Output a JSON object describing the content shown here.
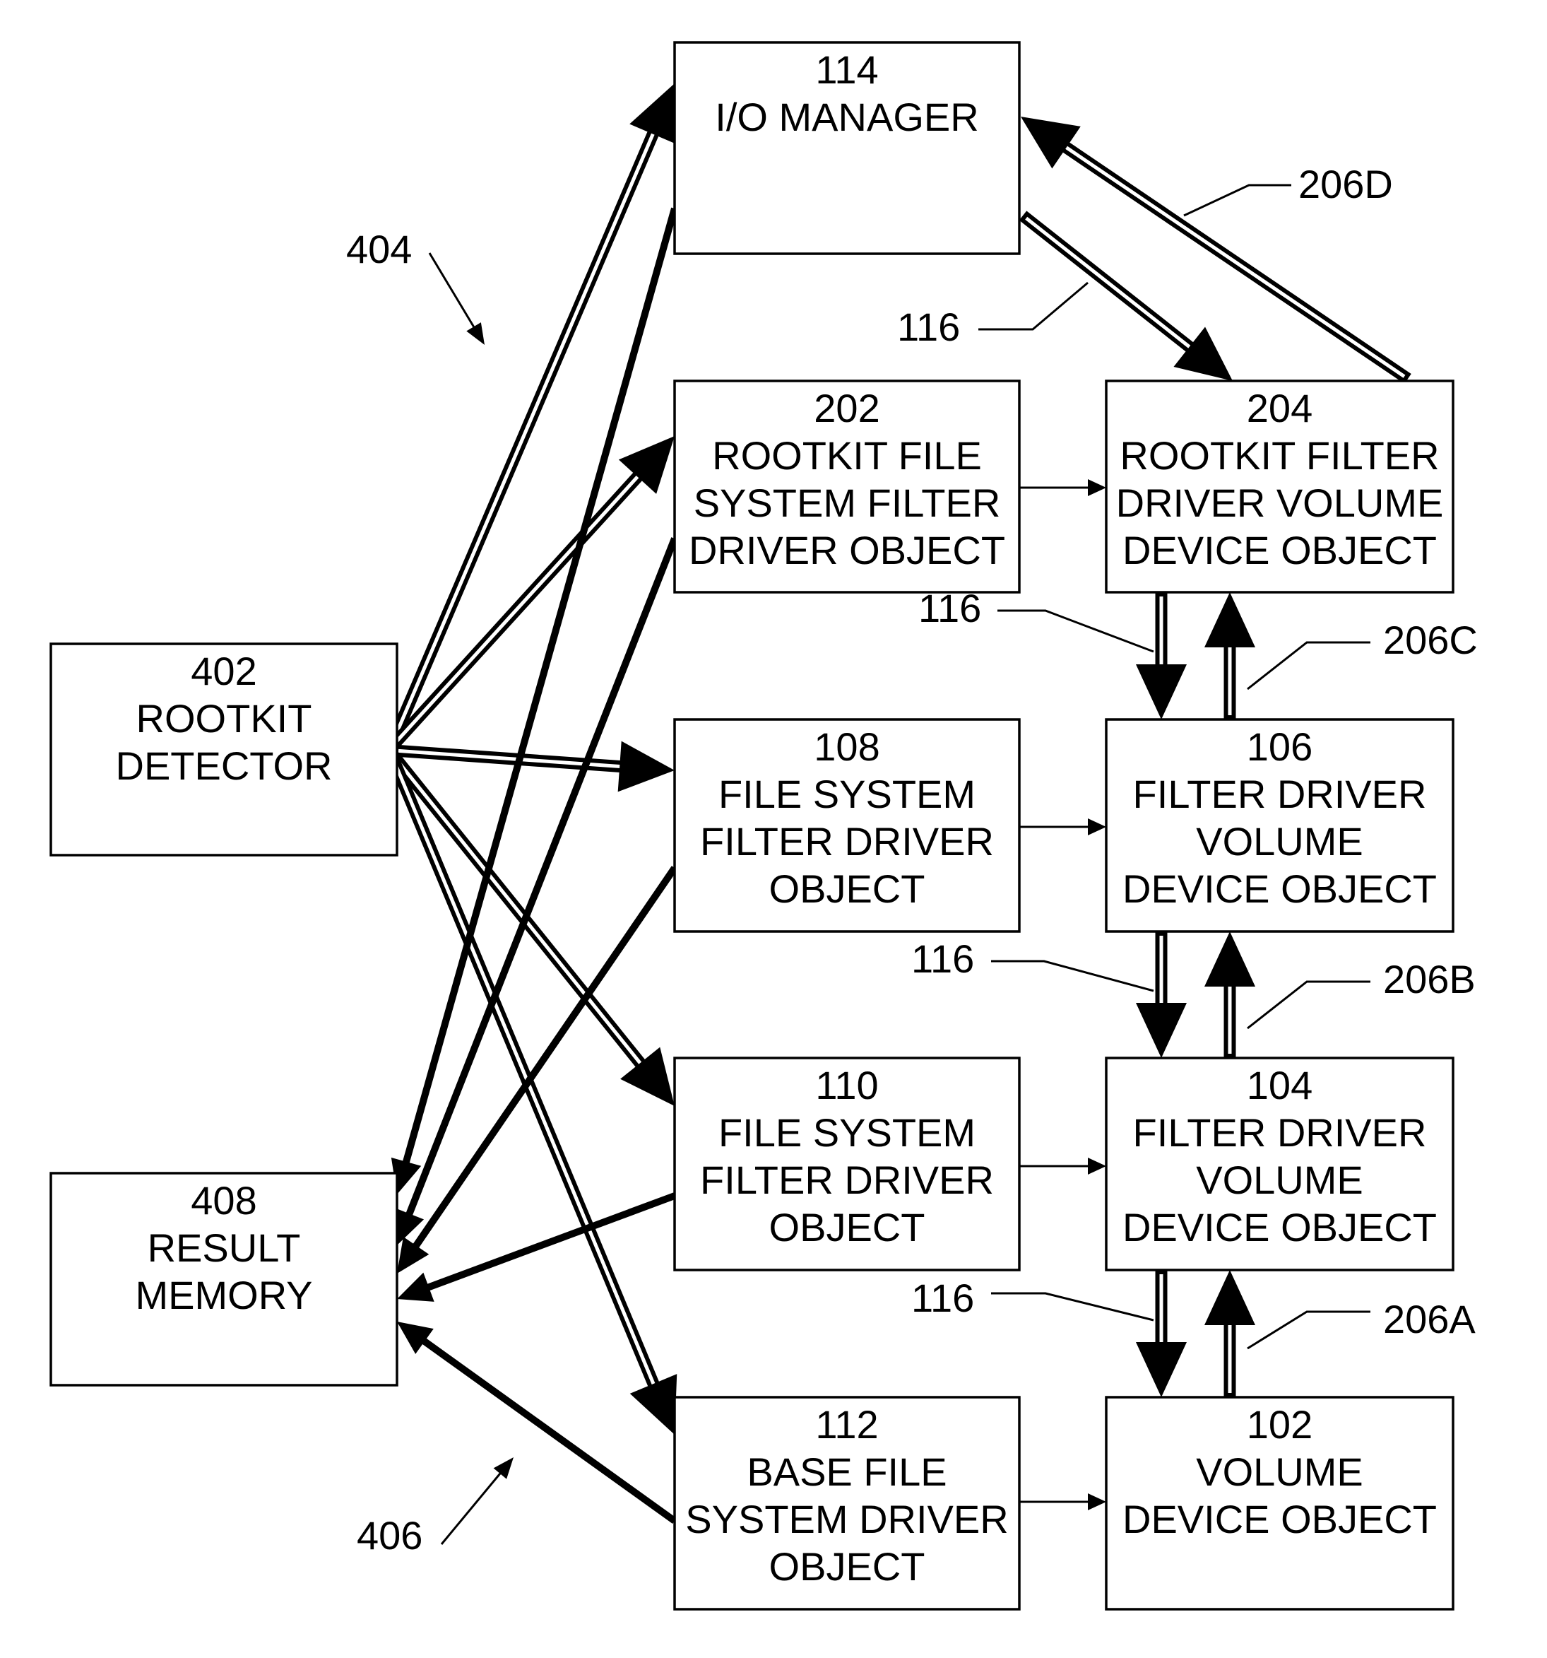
{
  "figure": {
    "boxes": [
      {
        "id": "114",
        "lines": [
          "114",
          "I/O MANAGER"
        ]
      },
      {
        "id": "202",
        "lines": [
          "202",
          "ROOTKIT FILE",
          "SYSTEM FILTER",
          "DRIVER OBJECT"
        ]
      },
      {
        "id": "204",
        "lines": [
          "204",
          "ROOTKIT FILTER",
          "DRIVER VOLUME",
          "DEVICE OBJECT"
        ]
      },
      {
        "id": "402",
        "lines": [
          "402",
          "ROOTKIT",
          "DETECTOR"
        ]
      },
      {
        "id": "108",
        "lines": [
          "108",
          "FILE SYSTEM",
          "FILTER DRIVER",
          "OBJECT"
        ]
      },
      {
        "id": "106",
        "lines": [
          "106",
          "FILTER DRIVER",
          "VOLUME",
          "DEVICE OBJECT"
        ]
      },
      {
        "id": "408",
        "lines": [
          "408",
          "RESULT",
          "MEMORY"
        ]
      },
      {
        "id": "110",
        "lines": [
          "110",
          "FILE SYSTEM",
          "FILTER DRIVER",
          "OBJECT"
        ]
      },
      {
        "id": "104",
        "lines": [
          "104",
          "FILTER DRIVER",
          "VOLUME",
          "DEVICE OBJECT"
        ]
      },
      {
        "id": "112",
        "lines": [
          "112",
          "BASE FILE",
          "SYSTEM DRIVER",
          "OBJECT"
        ]
      },
      {
        "id": "102",
        "lines": [
          "102",
          "VOLUME",
          "DEVICE OBJECT"
        ]
      }
    ],
    "reference_labels": [
      {
        "id": "ref-404",
        "text": "404"
      },
      {
        "id": "ref-406",
        "text": "406"
      },
      {
        "id": "ref-206d",
        "text": "206D"
      },
      {
        "id": "ref-116-top",
        "text": "116"
      },
      {
        "id": "ref-116-c",
        "text": "116"
      },
      {
        "id": "ref-206c",
        "text": "206C"
      },
      {
        "id": "ref-116-b",
        "text": "116"
      },
      {
        "id": "ref-206b",
        "text": "206B"
      },
      {
        "id": "ref-116-a",
        "text": "116"
      },
      {
        "id": "ref-206a",
        "text": "206A"
      }
    ],
    "connections": [
      {
        "from": "402",
        "to": "114",
        "style": "double",
        "name": "query-arrow-to-114"
      },
      {
        "from": "402",
        "to": "202",
        "style": "double",
        "name": "query-arrow-to-202"
      },
      {
        "from": "402",
        "to": "108",
        "style": "double",
        "name": "query-arrow-to-108"
      },
      {
        "from": "402",
        "to": "110",
        "style": "double",
        "name": "query-arrow-to-110"
      },
      {
        "from": "402",
        "to": "112",
        "style": "double",
        "name": "query-arrow-to-112"
      },
      {
        "from": "114",
        "to": "408",
        "style": "solid",
        "name": "result-arrow-from-114"
      },
      {
        "from": "202",
        "to": "408",
        "style": "solid",
        "name": "result-arrow-from-202"
      },
      {
        "from": "108",
        "to": "408",
        "style": "solid",
        "name": "result-arrow-from-108"
      },
      {
        "from": "110",
        "to": "408",
        "style": "solid",
        "name": "result-arrow-from-110"
      },
      {
        "from": "112",
        "to": "408",
        "style": "solid",
        "name": "result-arrow-from-112"
      },
      {
        "from": "202",
        "to": "204",
        "style": "thin",
        "name": "link-202-204"
      },
      {
        "from": "108",
        "to": "106",
        "style": "thin",
        "name": "link-108-106"
      },
      {
        "from": "110",
        "to": "104",
        "style": "thin",
        "name": "link-110-104"
      },
      {
        "from": "112",
        "to": "102",
        "style": "thin",
        "name": "link-112-102"
      },
      {
        "from": "114",
        "to": "204",
        "style": "double",
        "name": "irp-arrow-114-204"
      },
      {
        "from": "204",
        "to": "114",
        "style": "double",
        "name": "return-arrow-204-114"
      },
      {
        "from": "204",
        "to": "106",
        "style": "double",
        "name": "irp-arrow-204-106"
      },
      {
        "from": "106",
        "to": "204",
        "style": "double",
        "name": "return-arrow-106-204"
      },
      {
        "from": "106",
        "to": "104",
        "style": "double",
        "name": "irp-arrow-106-104"
      },
      {
        "from": "104",
        "to": "106",
        "style": "double",
        "name": "return-arrow-104-106"
      },
      {
        "from": "104",
        "to": "102",
        "style": "double",
        "name": "irp-arrow-104-102"
      },
      {
        "from": "102",
        "to": "104",
        "style": "double",
        "name": "return-arrow-102-104"
      }
    ]
  }
}
